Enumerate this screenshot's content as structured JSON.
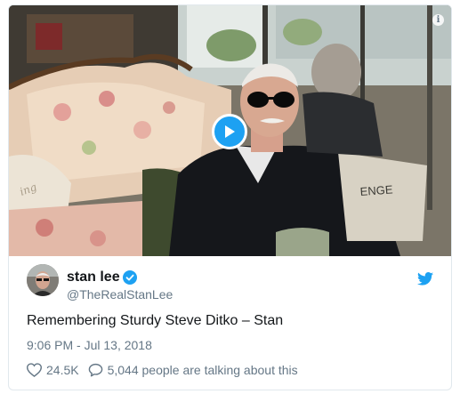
{
  "media": {
    "play_icon": "play-icon",
    "info_icon": "info-icon",
    "info_glyph": "i",
    "bag_text": "ENGE",
    "pillow_text": "ing"
  },
  "tweet": {
    "author_name": "stan lee",
    "handle": "@TheRealStanLee",
    "text": "Remembering Sturdy Steve Ditko – Stan",
    "timestamp": "9:06 PM - Jul 13, 2018",
    "likes": "24.5K",
    "talking": "5,044 people are talking about this"
  },
  "colors": {
    "accent": "#1da1f2",
    "text": "#14171a",
    "muted": "#657786"
  },
  "icons": {
    "verified": "verified-badge-icon",
    "bird": "twitter-bird-icon",
    "heart": "heart-icon",
    "reply": "speech-bubble-icon"
  }
}
